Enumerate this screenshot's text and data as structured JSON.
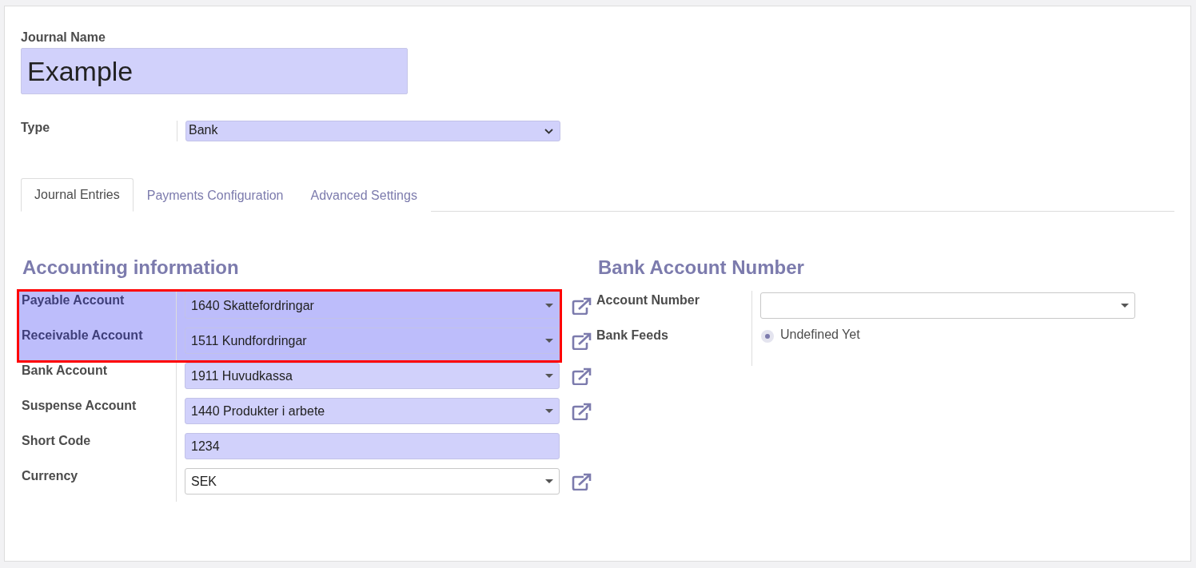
{
  "journal_name": {
    "label": "Journal Name",
    "value": "Example",
    "filled": true
  },
  "type": {
    "label": "Type",
    "value": "Bank",
    "filled": true
  },
  "tabs": [
    {
      "label": "Journal Entries",
      "selected": true
    },
    {
      "label": "Payments Configuration",
      "selected": false
    },
    {
      "label": "Advanced Settings",
      "selected": false
    }
  ],
  "accounting": {
    "heading": "Accounting information",
    "rows": [
      {
        "label": "Payable Account",
        "kind": "select",
        "value": "1640 Skattefordringar",
        "filled": true,
        "marked": true
      },
      {
        "label": "Receivable Account",
        "kind": "select",
        "value": "1511 Kundfordringar",
        "filled": true,
        "marked": true
      },
      {
        "label": "Bank Account",
        "kind": "select",
        "value": "1911 Huvudkassa",
        "filled": true,
        "marked": false
      },
      {
        "label": "Suspense Account",
        "kind": "select",
        "value": "1440 Produkter i arbete",
        "filled": true,
        "marked": false
      },
      {
        "label": "Short Code",
        "kind": "text",
        "value": "1234",
        "filled": true,
        "marked": false
      },
      {
        "label": "Currency",
        "kind": "select",
        "value": "SEK",
        "filled": false,
        "marked": false
      }
    ]
  },
  "bank": {
    "heading": "Bank Account Number",
    "rows": [
      {
        "label": "Account Number",
        "kind": "select",
        "filled": false
      },
      {
        "label": "Bank Feeds",
        "kind": "radio",
        "value": "Undefined Yet",
        "checked": true
      }
    ]
  }
}
